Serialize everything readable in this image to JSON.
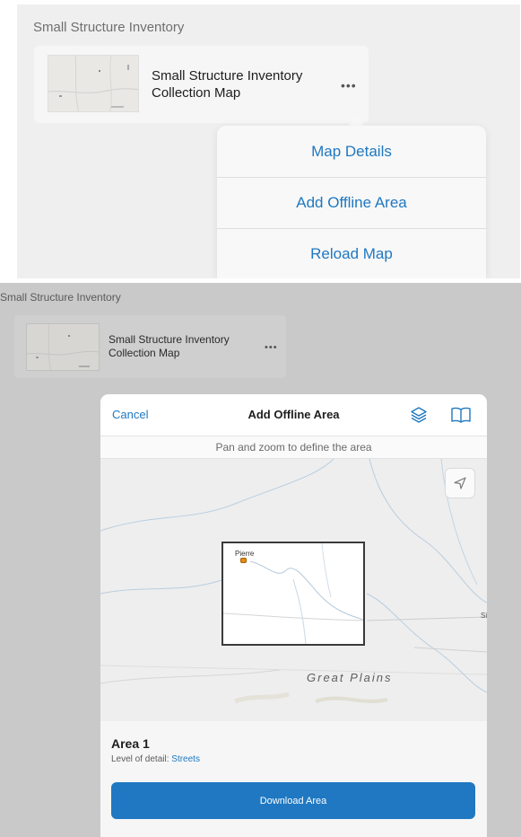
{
  "top": {
    "section_title": "Small Structure Inventory",
    "card_title": "Small Structure Inventory Collection Map",
    "more_icon": "more-horizontal-icon",
    "menu": [
      "Map Details",
      "Add Offline Area",
      "Reload Map"
    ]
  },
  "bottom": {
    "section_title": "Small Structure Inventory",
    "card_title": "Small Structure Inventory Collection Map",
    "more_icon": "more-horizontal-icon"
  },
  "modal": {
    "cancel_label": "Cancel",
    "title": "Add Offline Area",
    "layers_icon": "layers-icon",
    "bookmarks_icon": "bookmarks-icon",
    "hint": "Pan and zoom to define the area",
    "locate_icon": "location-arrow-icon",
    "map": {
      "city_label": "Pierre",
      "region_label": "Great Plains",
      "edge_label": "Si"
    },
    "area_name": "Area 1",
    "detail_label": "Level of detail:",
    "detail_value": "Streets",
    "download_label": "Download Area"
  },
  "colors": {
    "accent": "#1f78c1",
    "marker": "#e58c1a"
  }
}
